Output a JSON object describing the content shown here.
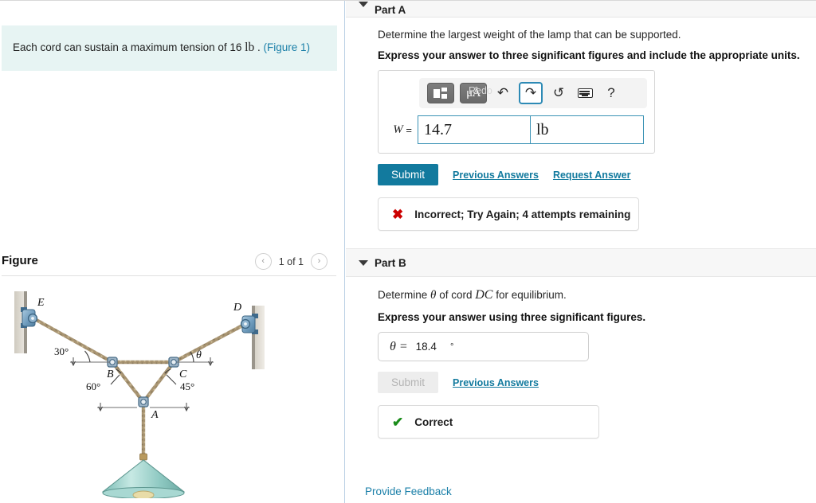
{
  "problem": {
    "text_before": "Each cord can sustain a maximum tension of 16",
    "unit": "lb",
    "text_after": ".",
    "figure_link": "(Figure 1)"
  },
  "figure_panel": {
    "title": "Figure",
    "pager_label": "1 of 1",
    "prev_glyph": "‹",
    "next_glyph": "›"
  },
  "figure": {
    "labels": {
      "E": "E",
      "D": "D",
      "B": "B",
      "C": "C",
      "A": "A",
      "angle_E": "30°",
      "angle_B": "60°",
      "angle_C": "45°",
      "angle_D": "θ"
    },
    "colors": {
      "cord": "#a89472",
      "bracket": "#7fa8c6",
      "lamp": "#9fd3cd",
      "wall": "#d8d4cc"
    }
  },
  "part_a": {
    "header": "Part A",
    "question": "Determine the largest weight of the lamp that can be supported.",
    "instruction": "Express your answer to three significant figures and include the appropriate units.",
    "toolbar": {
      "template_icon": "template-icon",
      "units_icon": "μÅ",
      "undo_glyph": "↶",
      "redo_glyph": "↷",
      "reset_glyph": "↺",
      "keyboard_icon": "keyboard-icon",
      "help_glyph": "?",
      "tooltip": "Redo"
    },
    "answer_label": "W =",
    "answer_value": "14.7",
    "answer_units": "lb",
    "submit_label": "Submit",
    "previous_answers_label": "Previous Answers",
    "request_answer_label": "Request Answer",
    "feedback": {
      "icon": "✖",
      "text": "Incorrect; Try Again; 4 attempts remaining"
    }
  },
  "part_b": {
    "header": "Part B",
    "question_prefix": "Determine",
    "question_theta": "θ",
    "question_mid": "of cord",
    "question_cord": "DC",
    "question_suffix": "for equilibrium.",
    "instruction": "Express your answer using three significant figures.",
    "answer_label": "θ =",
    "answer_value": "18.4",
    "answer_unit": "°",
    "submit_label": "Submit",
    "previous_answers_label": "Previous Answers",
    "feedback": {
      "icon": "✔",
      "text": "Correct"
    }
  },
  "footer": {
    "provide_feedback": "Provide Feedback"
  },
  "theme": {
    "accent": "#127a9e",
    "statement_bg": "#e7f4f3",
    "input_border": "#3b93b5",
    "correct": "#1a8c1a",
    "incorrect": "#cc0000"
  }
}
